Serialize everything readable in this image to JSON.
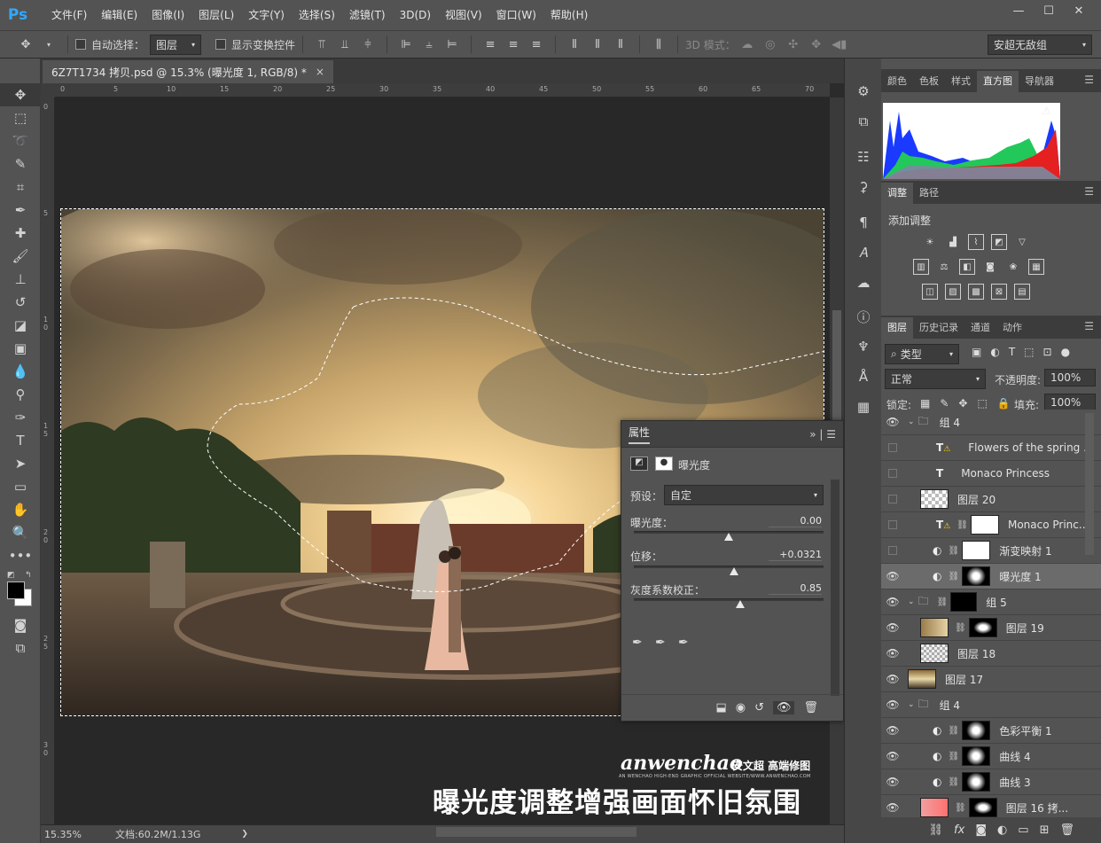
{
  "app": {
    "logo": "Ps"
  },
  "menu": [
    "文件(F)",
    "编辑(E)",
    "图像(I)",
    "图层(L)",
    "文字(Y)",
    "选择(S)",
    "滤镜(T)",
    "3D(D)",
    "视图(V)",
    "窗口(W)",
    "帮助(H)"
  ],
  "window_controls": {
    "minimize": "—",
    "restore": "☐",
    "close": "✕"
  },
  "options": {
    "auto_select_label": "自动选择：",
    "auto_select_value": "图层",
    "show_transform_label": "显示变换控件",
    "mode_3d_label": "3D 模式：",
    "workspace": "安超无敌组"
  },
  "document": {
    "tab_title": "6Z7T1734 拷贝.psd @ 15.3% (曝光度 1, RGB/8) *",
    "close": "×",
    "ruler_top": [
      "0",
      "5",
      "10",
      "15",
      "20",
      "25",
      "30",
      "35",
      "40",
      "45",
      "50",
      "55",
      "60",
      "65",
      "70"
    ],
    "ruler_left": [
      "0",
      "5",
      "1 0",
      "1 5",
      "2 0",
      "2 5",
      "3 0"
    ]
  },
  "caption": {
    "title": "曝光度调整增强画面怀旧氛围",
    "brand": "anwenchao",
    "brand_cn": "安文超 高端修图",
    "brand_sub": "AN WENCHAO HIGH-END GRAPHIC OFFICIAL WEBSITE/WWW.ANWENCHAO.COM"
  },
  "status": {
    "zoom": "15.35%",
    "doc_info": "文档:60.2M/1.13G",
    "arrow": "❯"
  },
  "properties": {
    "tab": "属性",
    "header_icons": "»",
    "title": "曝光度",
    "preset_label": "预设：",
    "preset_value": "自定",
    "exposure_label": "曝光度：",
    "exposure_value": "0.00",
    "exposure_pos": 0.5,
    "offset_label": "位移：",
    "offset_value": "+0.0321",
    "offset_pos": 0.53,
    "gamma_label": "灰度系数校正：",
    "gamma_value": "0.85",
    "gamma_pos": 0.56
  },
  "panels": {
    "top_tabs": [
      "颜色",
      "色板",
      "样式",
      "直方图",
      "导航器"
    ],
    "top_active": 3,
    "adj_tabs": [
      "调整",
      "路径"
    ],
    "adj_active": 0,
    "adj_title": "添加调整",
    "layer_tabs": [
      "图层",
      "历史记录",
      "通道",
      "动作"
    ],
    "layer_active": 0,
    "filter_label": "类型",
    "blend_mode": "正常",
    "opacity_label": "不透明度:",
    "opacity_value": "100%",
    "lock_label": "锁定:",
    "fill_label": "填充:",
    "fill_value": "100%"
  },
  "layers": [
    {
      "name": "组 4",
      "visible": true,
      "kind": "group",
      "indent": 0
    },
    {
      "name": "Flowers of the spring ...",
      "visible": false,
      "kind": "text-warn",
      "indent": 1
    },
    {
      "name": "Monaco Princess",
      "visible": false,
      "kind": "text",
      "indent": 1
    },
    {
      "name": "图层 20",
      "visible": false,
      "kind": "trans",
      "indent": 1
    },
    {
      "name": "Monaco Princ...",
      "visible": false,
      "kind": "text-mask",
      "indent": 1
    },
    {
      "name": "渐变映射 1",
      "visible": false,
      "kind": "adj-white",
      "indent": 1
    },
    {
      "name": "曝光度 1",
      "visible": true,
      "kind": "adj-dark",
      "indent": 1,
      "selected": true
    },
    {
      "name": "组 5",
      "visible": true,
      "kind": "group-mask",
      "indent": 0
    },
    {
      "name": "图层 19",
      "visible": true,
      "kind": "img-mask",
      "indent": 1
    },
    {
      "name": "图层 18",
      "visible": true,
      "kind": "img-trans",
      "indent": 1
    },
    {
      "name": "图层 17",
      "visible": true,
      "kind": "img",
      "indent": 0
    },
    {
      "name": "组 4",
      "visible": true,
      "kind": "group",
      "indent": 0
    },
    {
      "name": "色彩平衡 1",
      "visible": true,
      "kind": "adj-dark",
      "indent": 1
    },
    {
      "name": "曲线 4",
      "visible": true,
      "kind": "adj-dark",
      "indent": 1
    },
    {
      "name": "曲线 3",
      "visible": true,
      "kind": "adj-dark",
      "indent": 1
    },
    {
      "name": "图层 16 拷...",
      "visible": true,
      "kind": "img-red",
      "indent": 1
    }
  ],
  "colors": {
    "accent": "#31a8ff",
    "panel": "#535353",
    "dark": "#3c3c3c"
  }
}
